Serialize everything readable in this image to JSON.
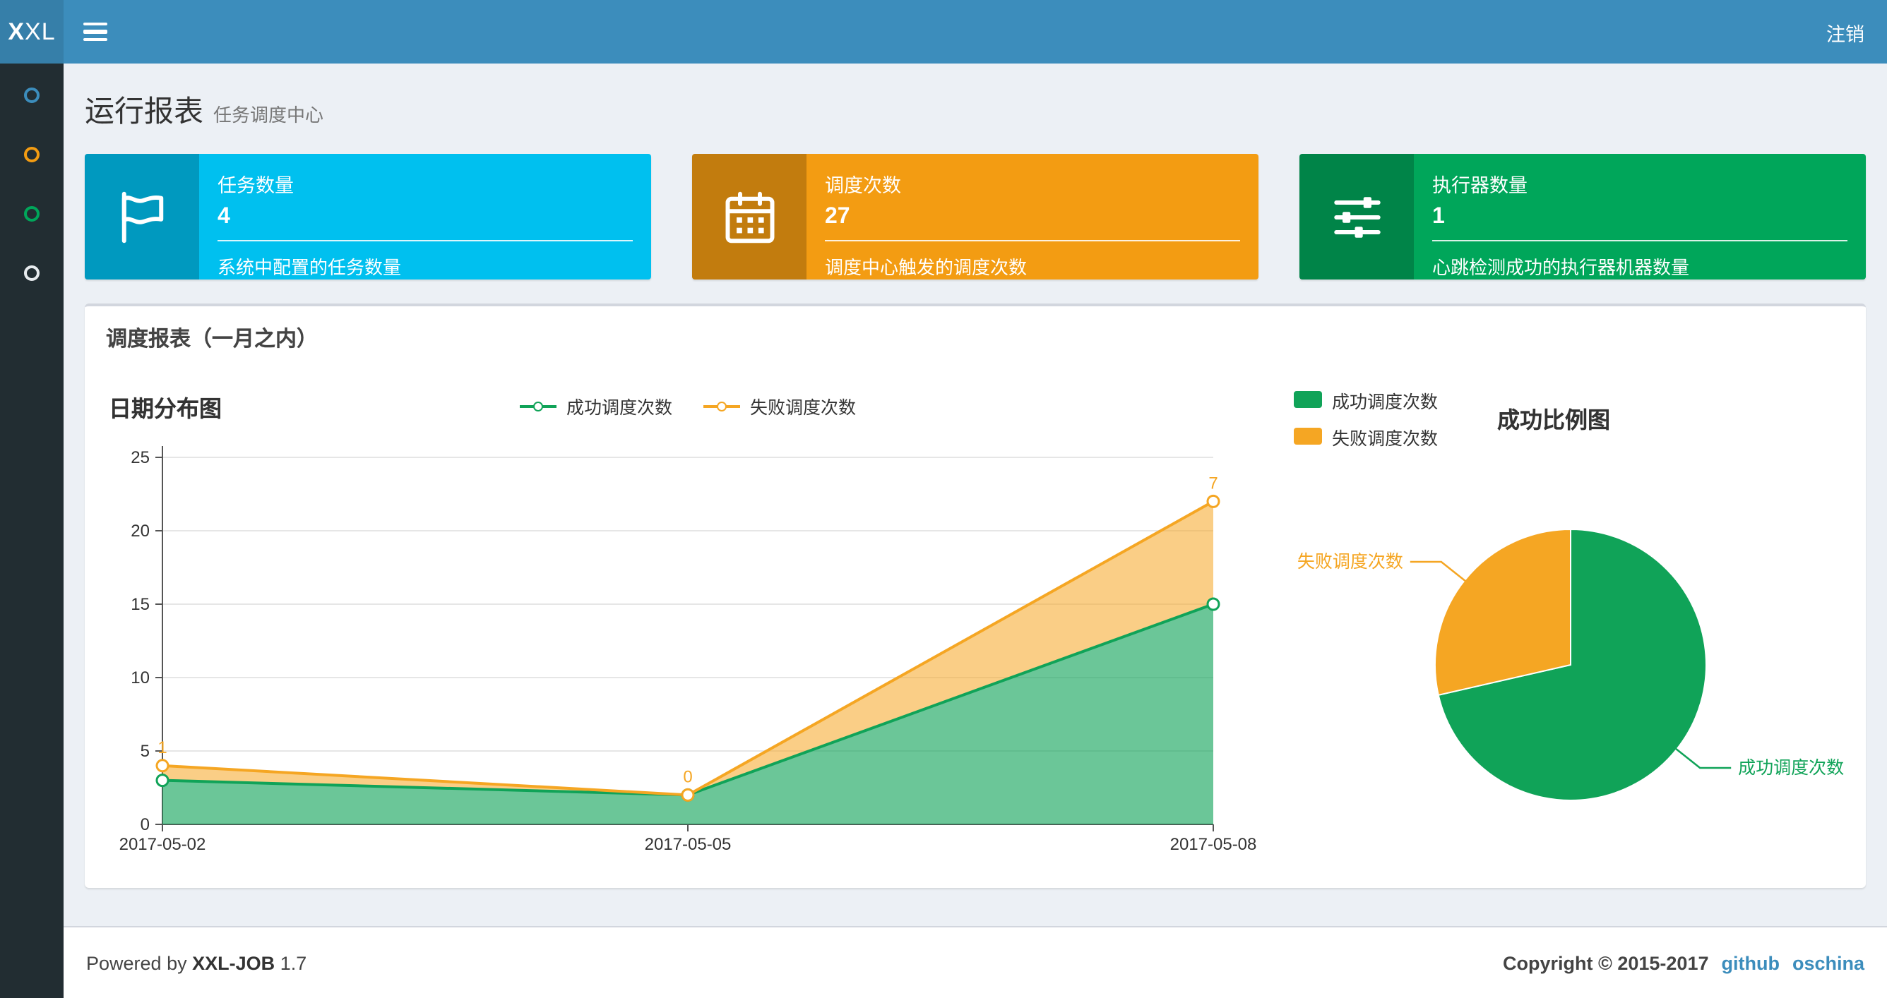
{
  "navbar": {
    "logo_bold": "X",
    "logo_rest": "XL",
    "logout": "注销"
  },
  "sidebar": {
    "items": [
      {
        "name": "report",
        "color": "#3c8dbc"
      },
      {
        "name": "job-manage",
        "color": "#f39c12"
      },
      {
        "name": "dispatch-log",
        "color": "#00a65a"
      },
      {
        "name": "executor-manage",
        "color": "#e7ebee"
      }
    ]
  },
  "page": {
    "title": "运行报表",
    "subtitle": "任务调度中心"
  },
  "info_boxes": [
    {
      "id": "jobs",
      "icon": "flag-icon",
      "color": "#00c0ef",
      "title": "任务数量",
      "value": "4",
      "desc": "系统中配置的任务数量"
    },
    {
      "id": "triggers",
      "icon": "calendar-icon",
      "color": "#f39c12",
      "title": "调度次数",
      "value": "27",
      "desc": "调度中心触发的调度次数"
    },
    {
      "id": "executors",
      "icon": "sliders-icon",
      "color": "#00a65a",
      "title": "执行器数量",
      "value": "1",
      "desc": "心跳检测成功的执行器机器数量"
    }
  ],
  "panel": {
    "title": "调度报表（一月之内）"
  },
  "chart_data": [
    {
      "type": "area",
      "title": "日期分布图",
      "x": [
        "2017-05-02",
        "2017-05-05",
        "2017-05-08"
      ],
      "stacked": true,
      "series": [
        {
          "name": "成功调度次数",
          "values": [
            3,
            2,
            15
          ],
          "color": "#10a358",
          "fill_opacity": 0.62
        },
        {
          "name": "失败调度次数",
          "values": [
            1,
            0,
            7
          ],
          "color": "#f5a623",
          "fill_opacity": 0.55,
          "point_labels": [
            "1",
            "0",
            "7"
          ]
        }
      ],
      "ylim": [
        0,
        25
      ],
      "yticks": [
        0,
        5,
        10,
        15,
        20,
        25
      ],
      "legend_position": "top-center",
      "grid": true
    },
    {
      "type": "pie",
      "title": "成功比例图",
      "slices": [
        {
          "name": "成功调度次数",
          "value": 20,
          "color": "#10a358"
        },
        {
          "name": "失败调度次数",
          "value": 8,
          "color": "#f5a623"
        }
      ],
      "legend_position": "top-left"
    }
  ],
  "footer": {
    "powered_prefix": "Powered by",
    "brand": "XXL-JOB",
    "version": "1.7",
    "copyright": "Copyright © 2015-2017",
    "links": [
      {
        "label": "github"
      },
      {
        "label": "oschina"
      }
    ]
  }
}
